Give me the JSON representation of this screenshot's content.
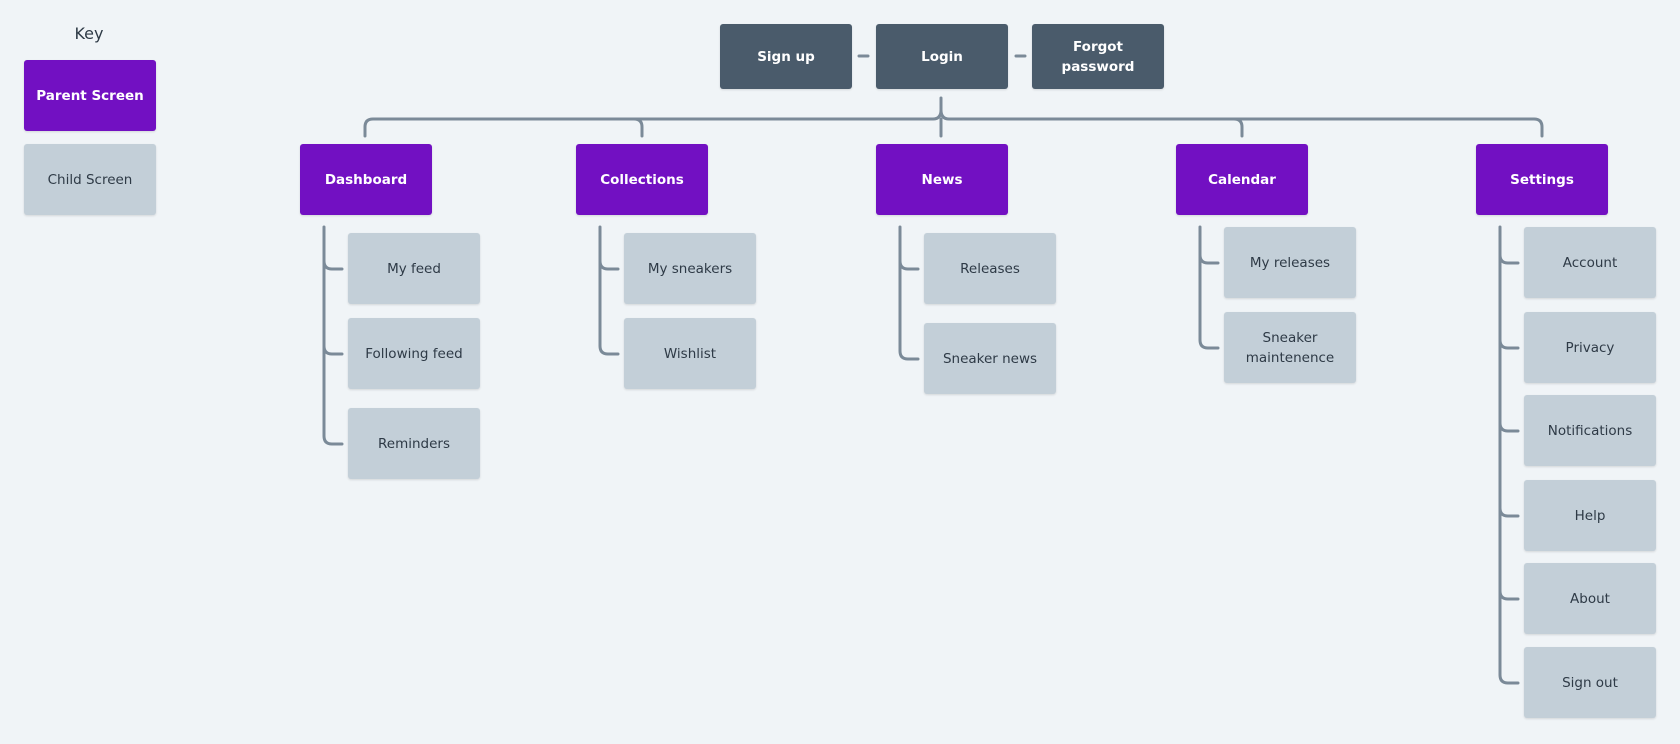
{
  "colors": {
    "background": "#f0f4f7",
    "parent": "#7210c2",
    "top": "#4a5b6b",
    "child": "#c3cfd8",
    "connector": "#7b8a98"
  },
  "key": {
    "title": "Key",
    "parent_label": "Parent Screen",
    "child_label": "Child Screen"
  },
  "auth": [
    "Sign up",
    "Login",
    "Forgot password"
  ],
  "sections": [
    {
      "label": "Dashboard",
      "children": [
        "My feed",
        "Following feed",
        "Reminders"
      ]
    },
    {
      "label": "Collections",
      "children": [
        "My sneakers",
        "Wishlist"
      ]
    },
    {
      "label": "News",
      "children": [
        "Releases",
        "Sneaker news"
      ]
    },
    {
      "label": "Calendar",
      "children": [
        "My releases",
        "Sneaker maintenence"
      ]
    },
    {
      "label": "Settings",
      "children": [
        "Account",
        "Privacy",
        "Notifications",
        "Help",
        "About",
        "Sign out"
      ]
    }
  ]
}
